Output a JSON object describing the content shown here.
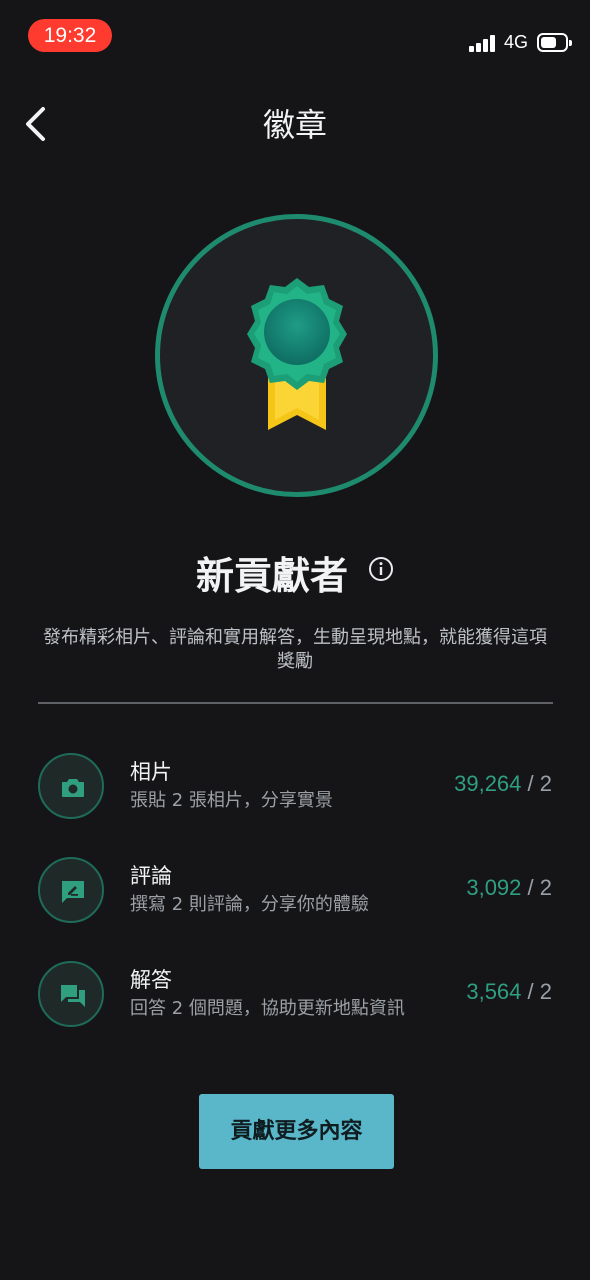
{
  "status_bar": {
    "time": "19:32",
    "network": "4G",
    "icons": [
      "signal-icon",
      "battery-icon"
    ]
  },
  "header": {
    "title": "徽章",
    "back_icon": "chevron-left-icon"
  },
  "badge": {
    "name": "新貢獻者",
    "description": "發布精彩相片、評論和實用解答，生動呈現地點，就能獲得這項獎勵",
    "icon": "medal-icon",
    "info_icon": "info-icon"
  },
  "tasks": [
    {
      "icon": "camera-icon",
      "title": "相片",
      "subtitle": "張貼 2 張相片，分享實景",
      "current": "39,264",
      "goal": "/ 2"
    },
    {
      "icon": "review-icon",
      "title": "評論",
      "subtitle": "撰寫 2 則評論，分享你的體驗",
      "current": "3,092",
      "goal": "/ 2"
    },
    {
      "icon": "answer-icon",
      "title": "解答",
      "subtitle": "回答 2 個問題，協助更新地點資訊",
      "current": "3,564",
      "goal": "/ 2"
    }
  ],
  "action": {
    "label": "貢獻更多內容"
  },
  "colors": {
    "background": "#151517",
    "accent_green": "#1e8a6e",
    "count_green": "#2f9f7f",
    "button": "#59b7c9",
    "status_time": "#ff3b30"
  }
}
